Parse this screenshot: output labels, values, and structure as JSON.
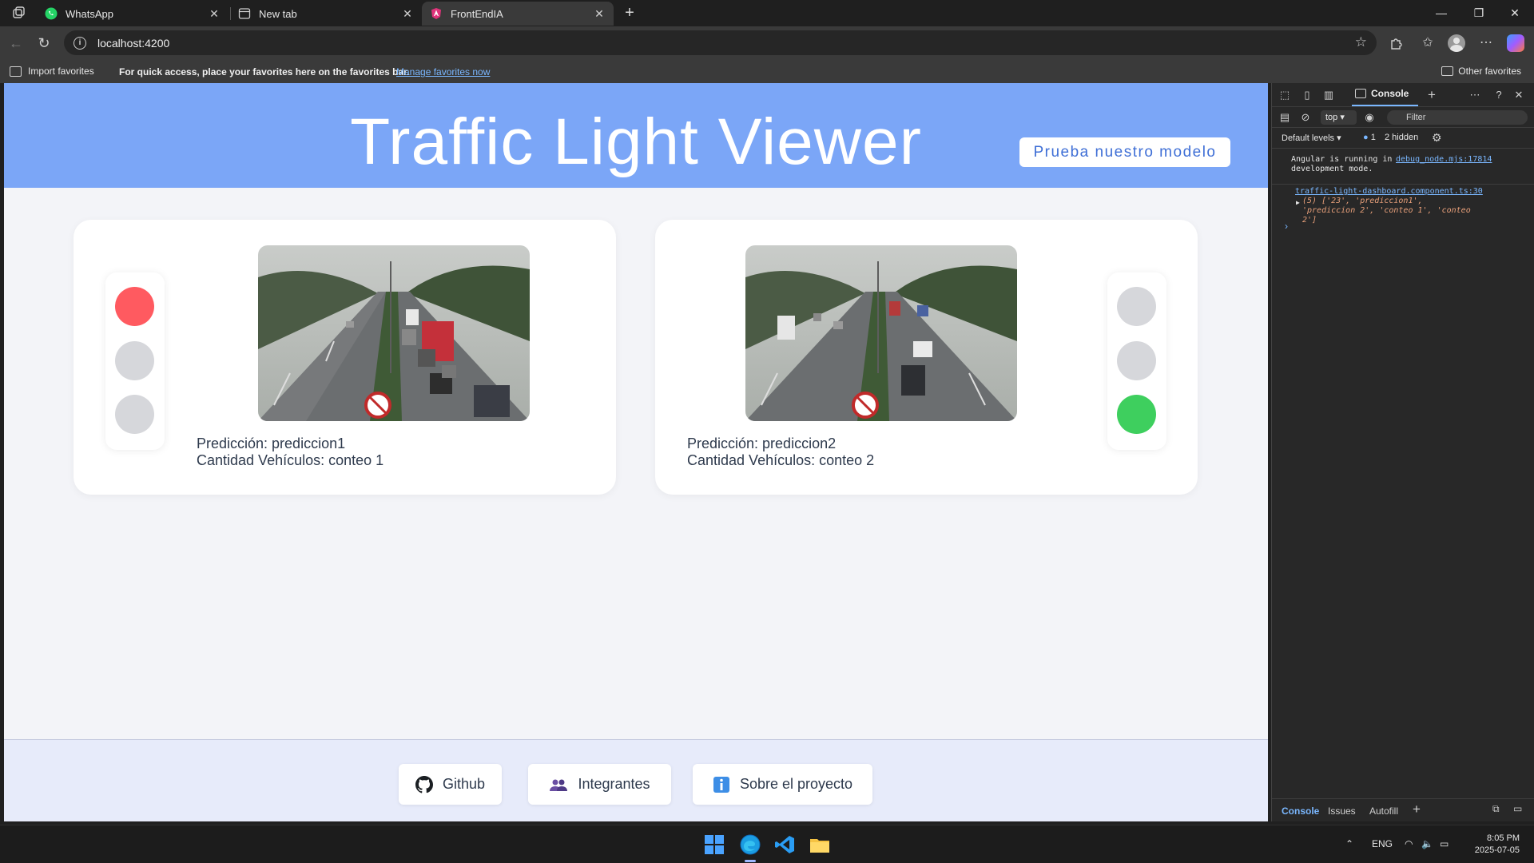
{
  "browser": {
    "tabs": [
      {
        "label": "WhatsApp",
        "icon": "whatsapp-icon"
      },
      {
        "label": "New tab",
        "icon": "new-tab-icon"
      },
      {
        "label": "FrontEndIA",
        "icon": "angular-icon",
        "active": true
      }
    ],
    "url": "localhost:4200",
    "favorites_bar": {
      "import_label": "Import favorites",
      "hint": "For quick access, place your favorites here on the favorites bar.",
      "manage_link": "Manage favorites now",
      "other_label": "Other favorites"
    }
  },
  "app": {
    "title": "Traffic Light Viewer",
    "try_button": "Prueba nuestro modelo",
    "colors": {
      "header": "#7ba6f7",
      "red_light": "#ff5a60",
      "green_light": "#3ecf5e",
      "off_light": "#d6d7db"
    },
    "cards": [
      {
        "prediction": "Predicción: prediccion1",
        "count": "Cantidad Vehículos: conteo 1",
        "active_light": "red",
        "light_side": "left"
      },
      {
        "prediction": "Predicción: prediccion2",
        "count": "Cantidad Vehículos: conteo 2",
        "active_light": "green",
        "light_side": "right"
      }
    ],
    "footer": [
      {
        "label": "Github",
        "icon": "github-icon"
      },
      {
        "label": "Integrantes",
        "icon": "people-icon"
      },
      {
        "label": "Sobre el proyecto",
        "icon": "info-icon"
      }
    ]
  },
  "devtools": {
    "active_tab": "Console",
    "context": "top",
    "filter_placeholder": "Filter",
    "levels": "Default levels",
    "issues_count": "1",
    "hidden": "2 hidden",
    "messages": [
      {
        "text": "Angular is running in development mode.",
        "source": "debug_node.mjs:17814"
      },
      {
        "source": "traffic-light-dashboard.component.ts:30",
        "text": "(5) ['23', 'prediccion1', 'prediccion 2', 'conteo 1', 'conteo 2']"
      }
    ],
    "bottom_tabs": [
      "Console",
      "Issues",
      "Autofill"
    ]
  },
  "taskbar": {
    "apps": [
      "windows-start-icon",
      "edge-icon",
      "vscode-icon",
      "file-explorer-icon"
    ],
    "lang": "ENG",
    "time": "8:05 PM",
    "date": "2025-07-05"
  }
}
